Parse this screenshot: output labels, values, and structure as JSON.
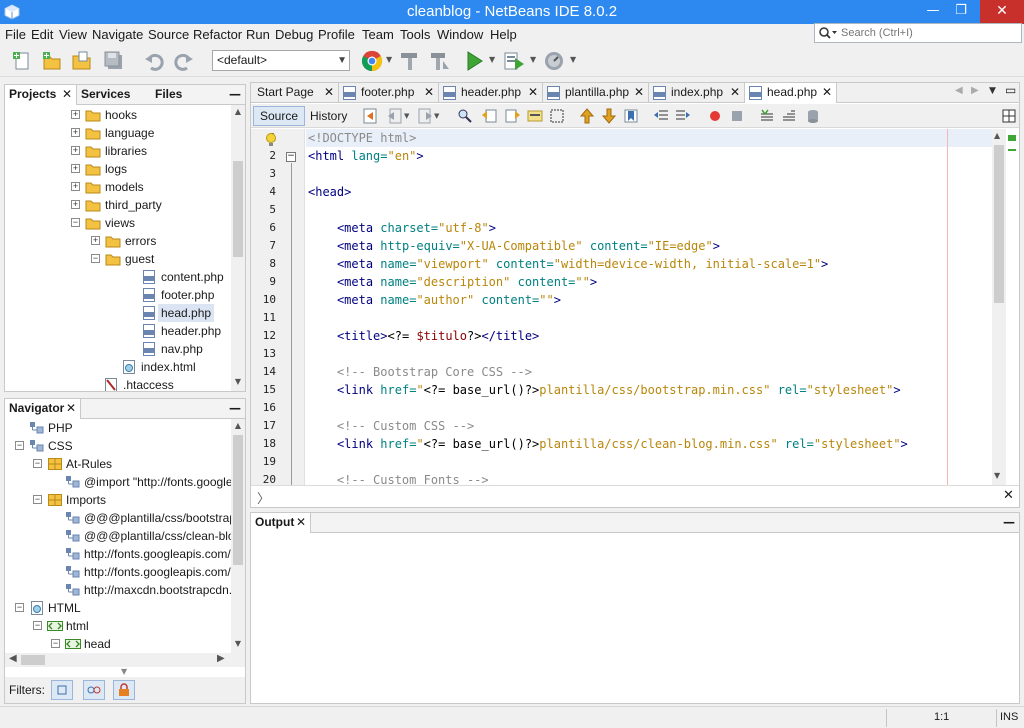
{
  "window": {
    "title": "cleanblog - NetBeans IDE 8.0.2",
    "minimize": "—",
    "maximize": "❐",
    "close": "✕"
  },
  "menu": [
    "File",
    "Edit",
    "View",
    "Navigate",
    "Source",
    "Refactor",
    "Run",
    "Debug",
    "Profile",
    "Team",
    "Tools",
    "Window",
    "Help"
  ],
  "search": {
    "placeholder": "Search (Ctrl+I)"
  },
  "toolbar": {
    "config": "<default>"
  },
  "projects_panel": {
    "tabs": [
      "Projects",
      "Services",
      "Files"
    ],
    "tree": [
      {
        "label": "hooks",
        "icon": "folder-icon",
        "expander": "+"
      },
      {
        "label": "language",
        "icon": "folder-icon",
        "expander": "+"
      },
      {
        "label": "libraries",
        "icon": "folder-icon",
        "expander": "+"
      },
      {
        "label": "logs",
        "icon": "folder-icon",
        "expander": "+"
      },
      {
        "label": "models",
        "icon": "folder-icon",
        "expander": "+"
      },
      {
        "label": "third_party",
        "icon": "folder-icon",
        "expander": "+"
      },
      {
        "label": "views",
        "icon": "folder-icon",
        "expander": "−"
      },
      {
        "label": "errors",
        "icon": "folder-icon",
        "expander": "+"
      },
      {
        "label": "guest",
        "icon": "folder-icon",
        "expander": "−"
      },
      {
        "label": "content.php",
        "icon": "php-file-icon"
      },
      {
        "label": "footer.php",
        "icon": "php-file-icon"
      },
      {
        "label": "head.php",
        "icon": "php-file-icon",
        "selected": true
      },
      {
        "label": "header.php",
        "icon": "php-file-icon"
      },
      {
        "label": "nav.php",
        "icon": "php-file-icon"
      },
      {
        "label": "index.html",
        "icon": "html-file-icon"
      },
      {
        "label": ".htaccess",
        "icon": "htaccess-file-icon"
      }
    ]
  },
  "navigator_panel": {
    "title": "Navigator",
    "tree": [
      {
        "label": "PHP",
        "icon": "php-node-icon"
      },
      {
        "label": "CSS",
        "icon": "css-node-icon",
        "expander": "−"
      },
      {
        "label": "At-Rules",
        "icon": "at-rules-icon",
        "expander": "−"
      },
      {
        "label": "@import \"http://fonts.googlea",
        "icon": "css-rule-icon"
      },
      {
        "label": "Imports",
        "icon": "imports-icon",
        "expander": "−"
      },
      {
        "label": "@@@plantilla/css/bootstrap.n",
        "icon": "css-rule-icon"
      },
      {
        "label": "@@@plantilla/css/clean-blog.",
        "icon": "css-rule-icon"
      },
      {
        "label": "http://fonts.googleapis.com/c",
        "icon": "css-rule-icon"
      },
      {
        "label": "http://fonts.googleapis.com/c",
        "icon": "css-rule-icon"
      },
      {
        "label": "http://maxcdn.bootstrapcdn.c",
        "icon": "css-rule-icon"
      },
      {
        "label": "HTML",
        "icon": "html-node-icon",
        "expander": "−"
      },
      {
        "label": "html",
        "icon": "html-tag-icon",
        "expander": "−"
      },
      {
        "label": "head",
        "icon": "html-tag-icon",
        "expander": "−"
      }
    ],
    "filters_label": "Filters:"
  },
  "editor": {
    "tabs": [
      "Start Page",
      "footer.php",
      "header.php",
      "plantilla.php",
      "index.php",
      "head.php"
    ],
    "active_tab": "head.php",
    "source_btn": "Source",
    "history_btn": "History",
    "line_numbers": [
      "1",
      "2",
      "3",
      "4",
      "5",
      "6",
      "7",
      "8",
      "9",
      "10",
      "11",
      "12",
      "13",
      "14",
      "15",
      "16",
      "17",
      "18",
      "19",
      "20"
    ],
    "lines": [
      "<!DOCTYPE html>",
      "<html lang=\"en\">",
      "",
      "<head>",
      "",
      "    <meta charset=\"utf-8\">",
      "    <meta http-equiv=\"X-UA-Compatible\" content=\"IE=edge\">",
      "    <meta name=\"viewport\" content=\"width=device-width, initial-scale=1\">",
      "    <meta name=\"description\" content=\"\">",
      "    <meta name=\"author\" content=\"\">",
      "",
      "    <title><?= $titulo?></title>",
      "",
      "    <!-- Bootstrap Core CSS -->",
      "    <link href=\"<?= base_url()?>plantilla/css/bootstrap.min.css\" rel=\"stylesheet\">",
      "",
      "    <!-- Custom CSS -->",
      "    <link href=\"<?= base_url()?>plantilla/css/clean-blog.min.css\" rel=\"stylesheet\">",
      "",
      "    <!-- Custom Fonts -->"
    ]
  },
  "output_panel": {
    "title": "Output"
  },
  "status": {
    "position": "1:1",
    "mode": "INS"
  }
}
